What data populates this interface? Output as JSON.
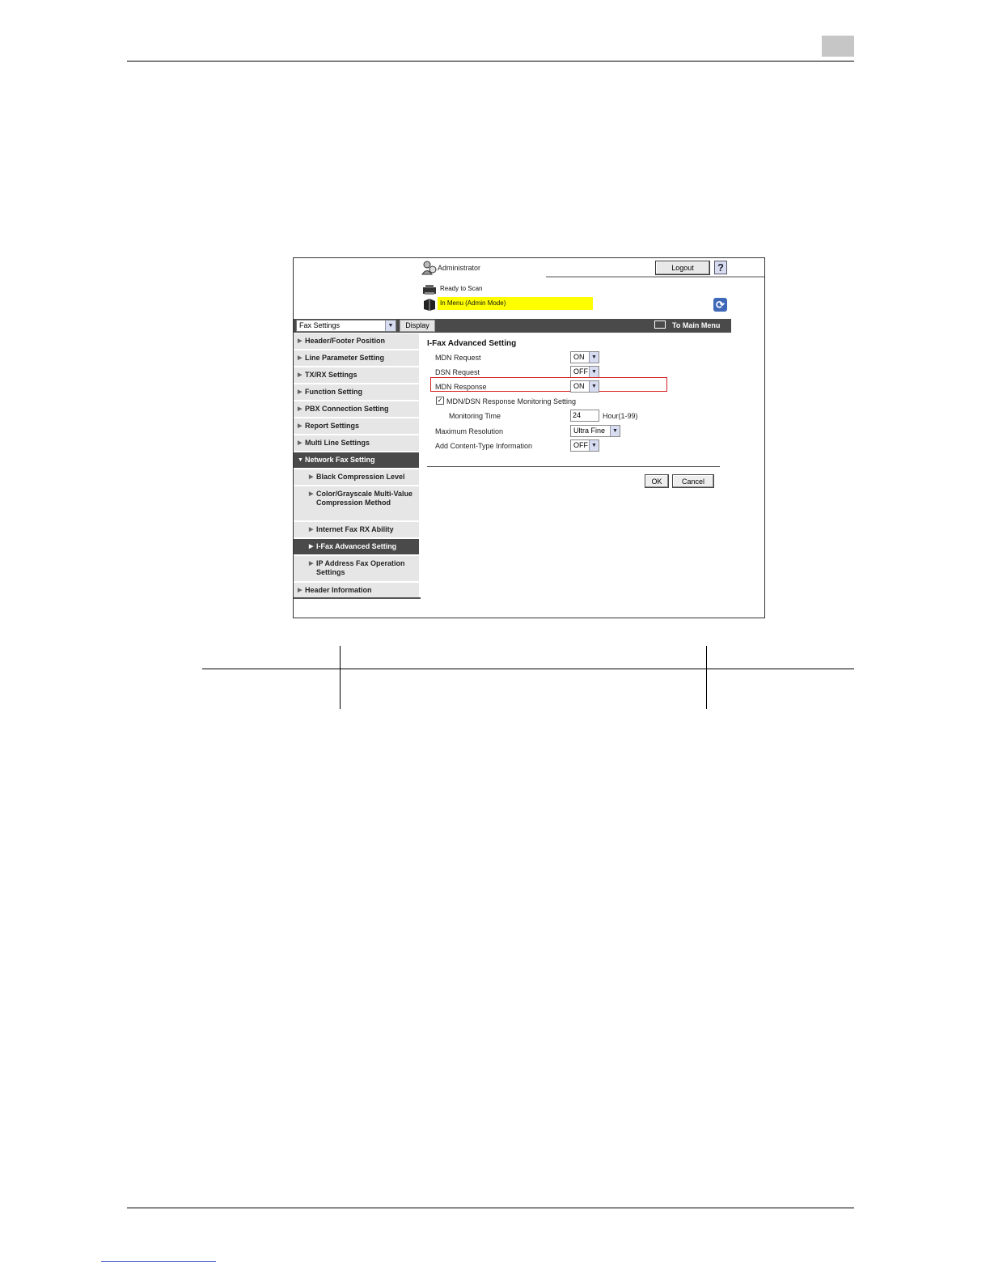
{
  "admin": {
    "user_label": "Administrator",
    "logout_label": "Logout",
    "help_label": "?"
  },
  "status": {
    "ready": "Ready to Scan",
    "menu": "In Menu (Admin Mode)"
  },
  "nav": {
    "category_value": "Fax Settings",
    "display_label": "Display",
    "main_menu_label": "To Main Menu"
  },
  "sidebar": {
    "items": [
      {
        "label": "Header/Footer Position"
      },
      {
        "label": "Line Parameter Setting"
      },
      {
        "label": "TX/RX Settings"
      },
      {
        "label": "Function Setting"
      },
      {
        "label": "PBX Connection Setting"
      },
      {
        "label": "Report Settings"
      },
      {
        "label": "Multi Line Settings"
      },
      {
        "label": "Network Fax Setting",
        "expanded": true
      },
      {
        "label": "Black Compression Level"
      },
      {
        "label": "Color/Grayscale Multi-Value Compression Method"
      },
      {
        "label": "Internet Fax RX Ability"
      },
      {
        "label": "I-Fax Advanced Setting",
        "selected": true
      },
      {
        "label": "IP Address Fax Operation Settings"
      },
      {
        "label": "Header Information"
      }
    ]
  },
  "form": {
    "title": "I-Fax Advanced Setting",
    "mdn_request": {
      "label": "MDN Request",
      "value": "ON"
    },
    "dsn_request": {
      "label": "DSN Request",
      "value": "OFF"
    },
    "mdn_response": {
      "label": "MDN Response",
      "value": "ON"
    },
    "monitoring": {
      "label": "MDN/DSN Response Monitoring Setting",
      "checked": true
    },
    "monitoring_time": {
      "label": "Monitoring Time",
      "value": "24",
      "unit": "Hour(1-99)"
    },
    "max_resolution": {
      "label": "Maximum Resolution",
      "value": "Ultra Fine"
    },
    "content_type": {
      "label": "Add Content-Type Information",
      "value": "OFF"
    },
    "ok_label": "OK",
    "cancel_label": "Cancel"
  },
  "colors": {
    "highlight": "#ffff00",
    "nav_bar": "#4a4a4a",
    "focus_box": "#d42020"
  }
}
